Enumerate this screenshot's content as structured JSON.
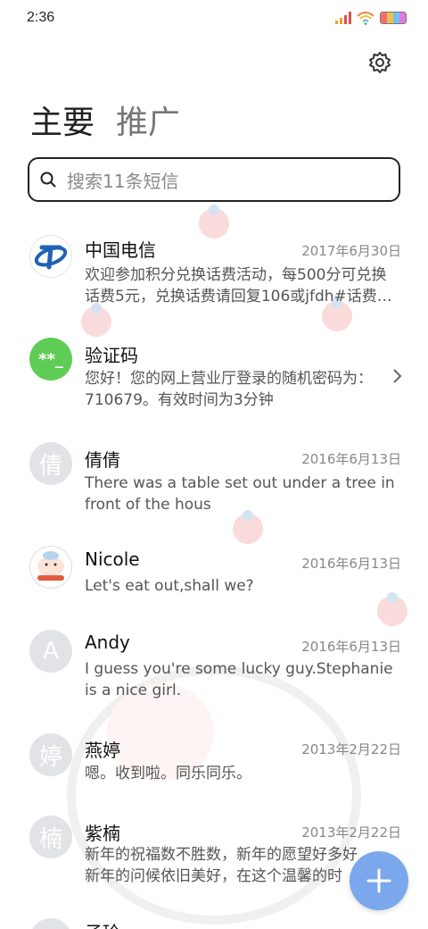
{
  "status_bar": {
    "time": "2:36"
  },
  "header": {
    "tab_main": "主要",
    "tab_promo": "推广"
  },
  "search": {
    "placeholder": "搜索11条短信"
  },
  "threads": [
    {
      "name": "中国电信",
      "date": "2017年6月30日",
      "preview_lines": [
        "欢迎参加积分兑换话费活动，每500分可兑换",
        "话费5元，兑换话费请回复106或jfdh#话费…"
      ]
    },
    {
      "name": "验证码",
      "avatar_text": "**_",
      "preview_lines": [
        "您好！您的网上营业厅登录的随机密码为：",
        "710679。有效时间为3分钟"
      ]
    },
    {
      "name": "倩倩",
      "avatar_text": "倩",
      "date": "2016年6月13日",
      "preview_lines": [
        "There was a table set out under a tree in",
        "front of the hous"
      ]
    },
    {
      "name": "Nicole",
      "date": "2016年6月13日",
      "preview_lines": [
        "Let's eat out,shall we?"
      ]
    },
    {
      "name": "Andy",
      "avatar_text": "A",
      "date": "2016年6月13日",
      "preview_lines": [
        "I guess you're some lucky guy.Stephanie",
        "is a nice girl."
      ]
    },
    {
      "name": "燕婷",
      "avatar_text": "婷",
      "date": "2013年2月22日",
      "preview_lines": [
        "嗯。收到啦。同乐同乐。"
      ]
    },
    {
      "name": "紫楠",
      "avatar_text": "楠",
      "date": "2013年2月22日",
      "preview_lines": [
        "新年的祝福数不胜数，新年的愿望好多好",
        "新年的问候依旧美好，在这个温馨的时"
      ]
    },
    {
      "name": "子玲",
      "avatar_text": "子"
    }
  ],
  "colors": {
    "accent": "#7ba8ec",
    "verify_avatar": "#5fcd55",
    "telecom_blue": "#1f63b5"
  }
}
